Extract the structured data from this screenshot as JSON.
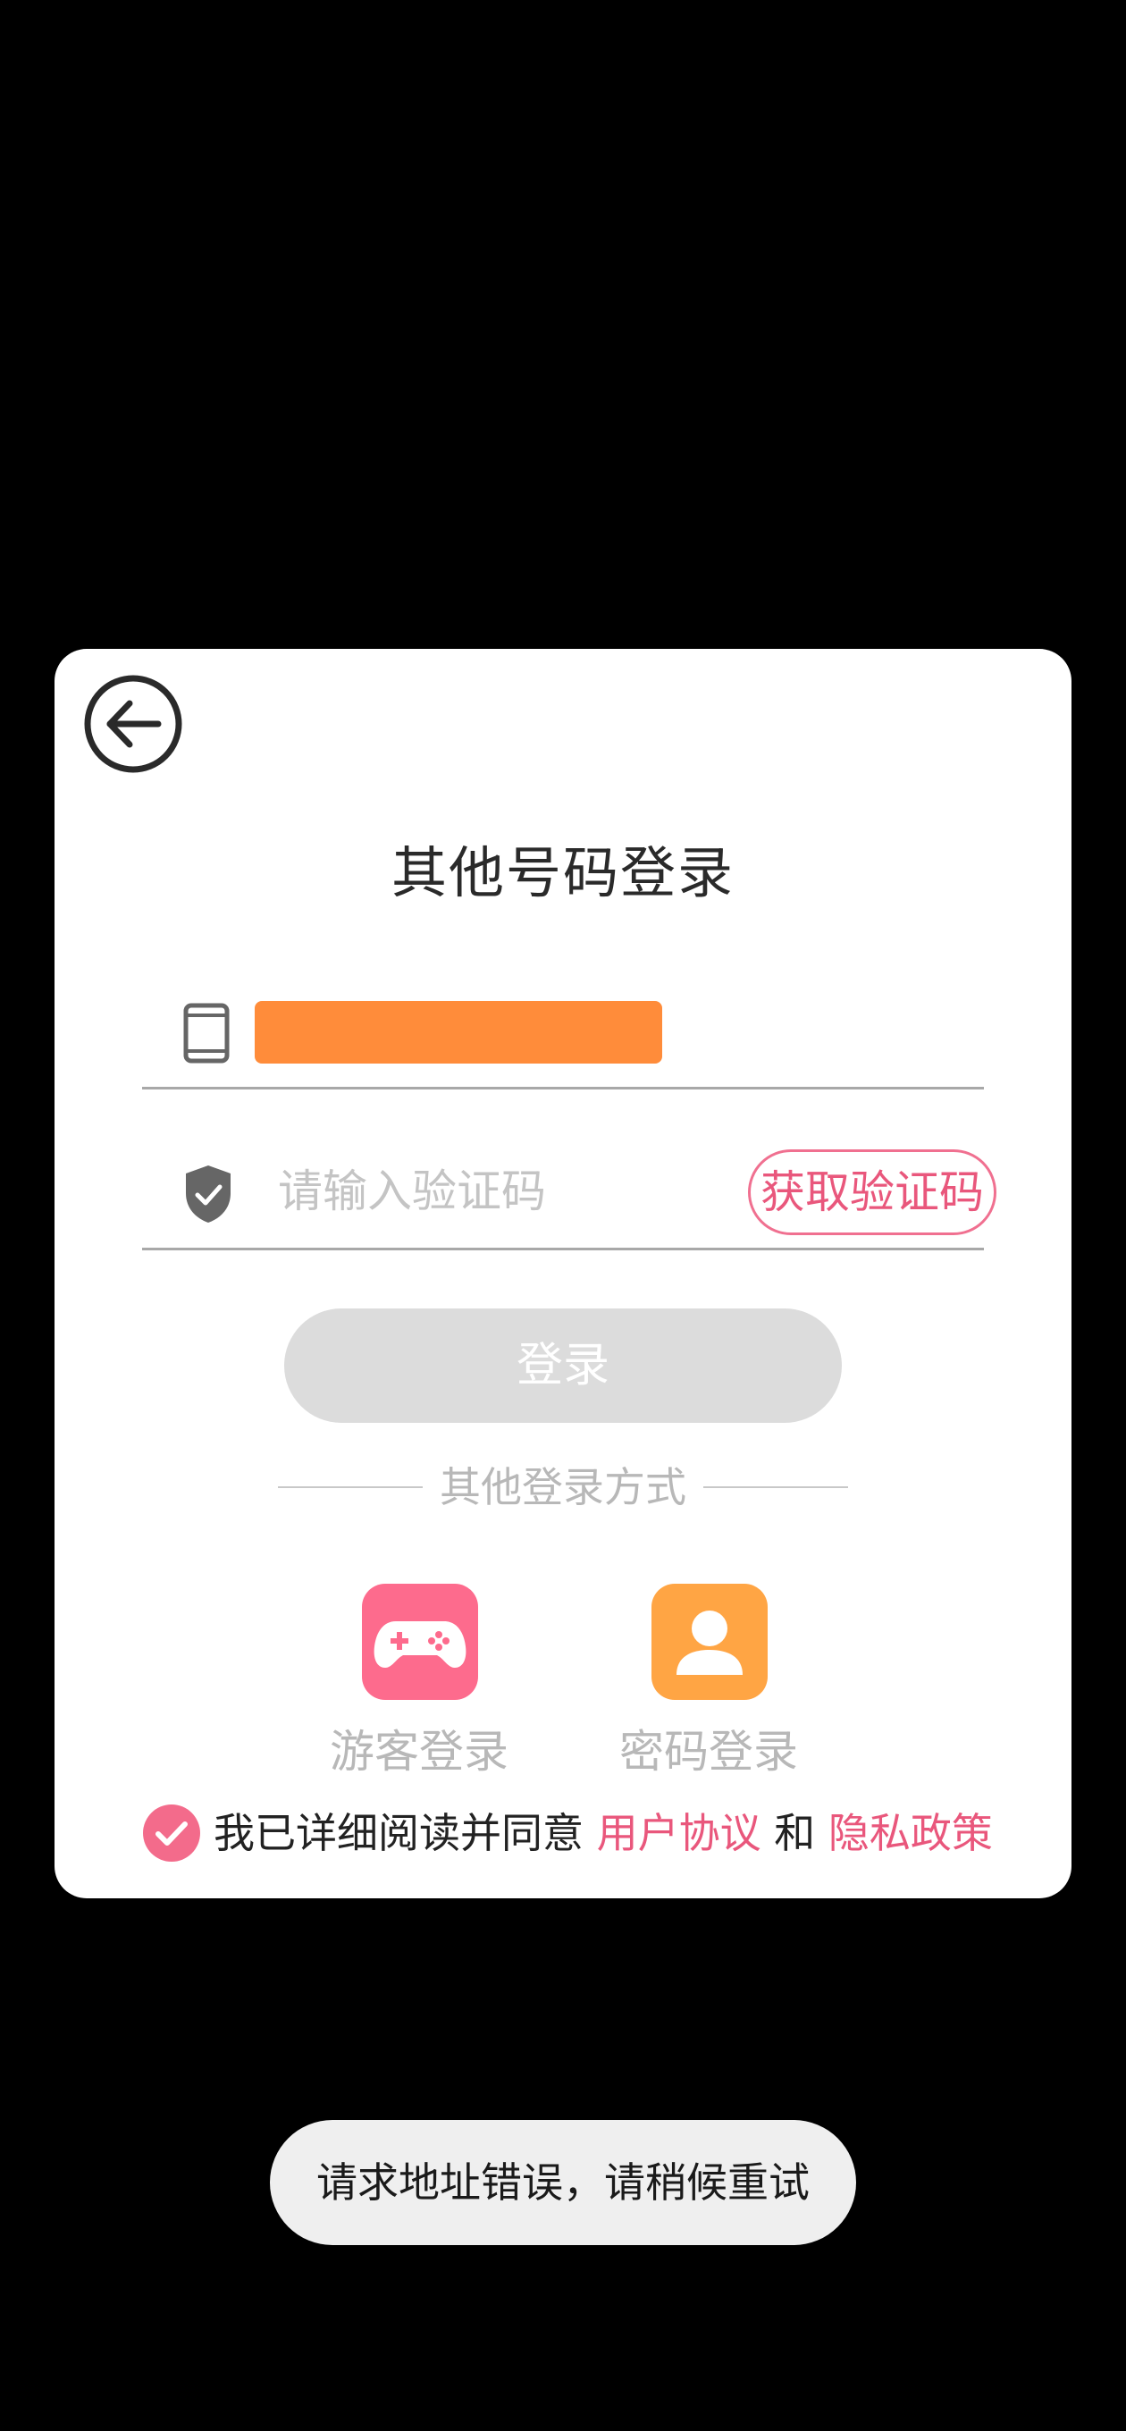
{
  "dialog": {
    "title": "其他号码登录",
    "phone_field": {
      "value": "",
      "redacted_color": "#ff8c3a"
    },
    "code_field": {
      "placeholder": "请输入验证码",
      "value": ""
    },
    "get_code_label": "获取验证码",
    "login_label": "登录",
    "divider_label": "其他登录方式",
    "alt_logins": [
      {
        "label": "游客登录",
        "icon": "gamepad-icon",
        "color": "#fd6b8d"
      },
      {
        "label": "密码登录",
        "icon": "user-icon",
        "color": "#ffa544"
      }
    ],
    "agreement": {
      "checked": true,
      "prefix": "我已详细阅读并同意",
      "user_agreement": "用户协议",
      "and": "和",
      "privacy_policy": "隐私政策"
    }
  },
  "toast": {
    "message": "请求地址错误，请稍候重试"
  },
  "colors": {
    "accent": "#e9577c",
    "disabled_button": "#dcdcdc",
    "background": "#000000"
  }
}
